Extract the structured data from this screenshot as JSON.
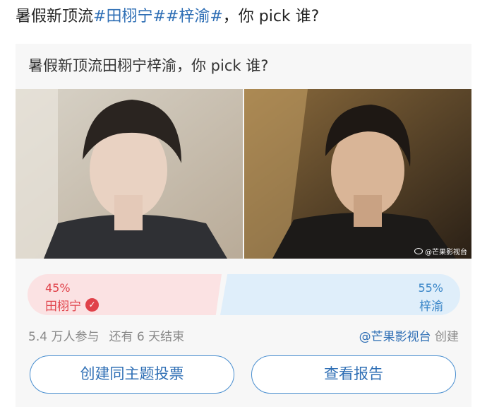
{
  "post": {
    "title_prefix": "暑假新顶流",
    "tag_1": "#田栩宁#",
    "tag_2": "#梓渝#",
    "title_suffix": "，你 pick 谁?"
  },
  "poll": {
    "title": "暑假新顶流田栩宁梓渝，你 pick 谁?",
    "options": [
      {
        "name": "田栩宁",
        "percent": "45%",
        "selected": true,
        "color": "#e0424a"
      },
      {
        "name": "梓渝",
        "percent": "55%",
        "selected": false,
        "color": "#3a86c8"
      }
    ],
    "participants": "5.4 万人参与",
    "remaining": "还有 6 天结束",
    "author": "@芒果影视台",
    "author_suffix": "创建",
    "watermark": "@芒果影视台"
  },
  "buttons": {
    "create_label": "创建同主题投票",
    "report_label": "查看报告"
  },
  "colors": {
    "link": "#2f6fb5",
    "left_bar": "#fbe2e3",
    "right_bar": "#dfeefa"
  }
}
